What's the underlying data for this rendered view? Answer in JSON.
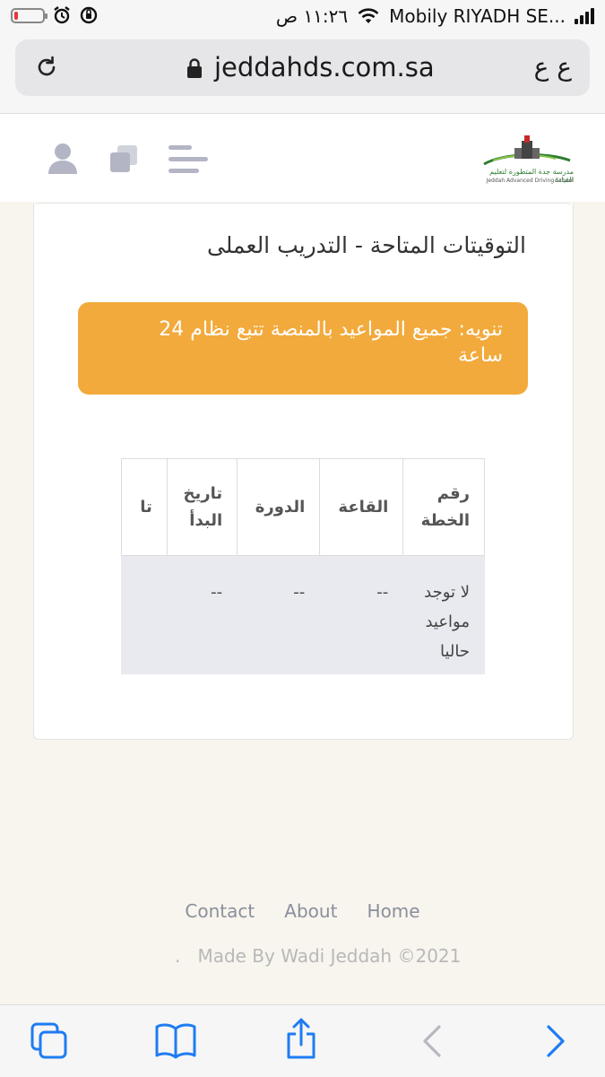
{
  "status_bar": {
    "carrier": "Mobily RIYADH SE...",
    "time": "١١:٢٦ ص",
    "battery_level": 0.1,
    "battery_color": "#e53935"
  },
  "browser": {
    "url": "jeddahds.com.sa",
    "text_size_label": "ع ع",
    "icons": [
      "reload-icon",
      "lock-icon"
    ]
  },
  "site_header": {
    "logo_text_ar": "مدرسة جدة المتطورة لتعليم القيادة",
    "logo_text_en": "Jeddah Advanced Driving School",
    "icons": [
      "menu-icon",
      "windows-icon",
      "avatar-icon"
    ]
  },
  "main": {
    "title": "التوقيتات المتاحة - التدريب العملى",
    "notice": "تنويه: جميع المواعيد بالمنصة تتبع نظام 24 ساعة",
    "notice_color": "#f2aa3c",
    "table": {
      "headers": [
        "رقم الخطة",
        "القاعة",
        "الدورة",
        "تاريخ البدأ",
        "تا"
      ],
      "rows": [
        [
          "لا توجد مواعيد حاليا",
          "--",
          "--",
          "--",
          ""
        ]
      ]
    }
  },
  "footer": {
    "links": [
      "Contact",
      "About",
      "Home"
    ],
    "copyright": "Made By Wadi Jeddah ©2021",
    "dot": "."
  },
  "toolbar": {
    "icons": [
      "tabs-icon",
      "bookmarks-icon",
      "share-icon",
      "back-icon",
      "forward-icon"
    ],
    "accent": "#1e7cf2"
  }
}
